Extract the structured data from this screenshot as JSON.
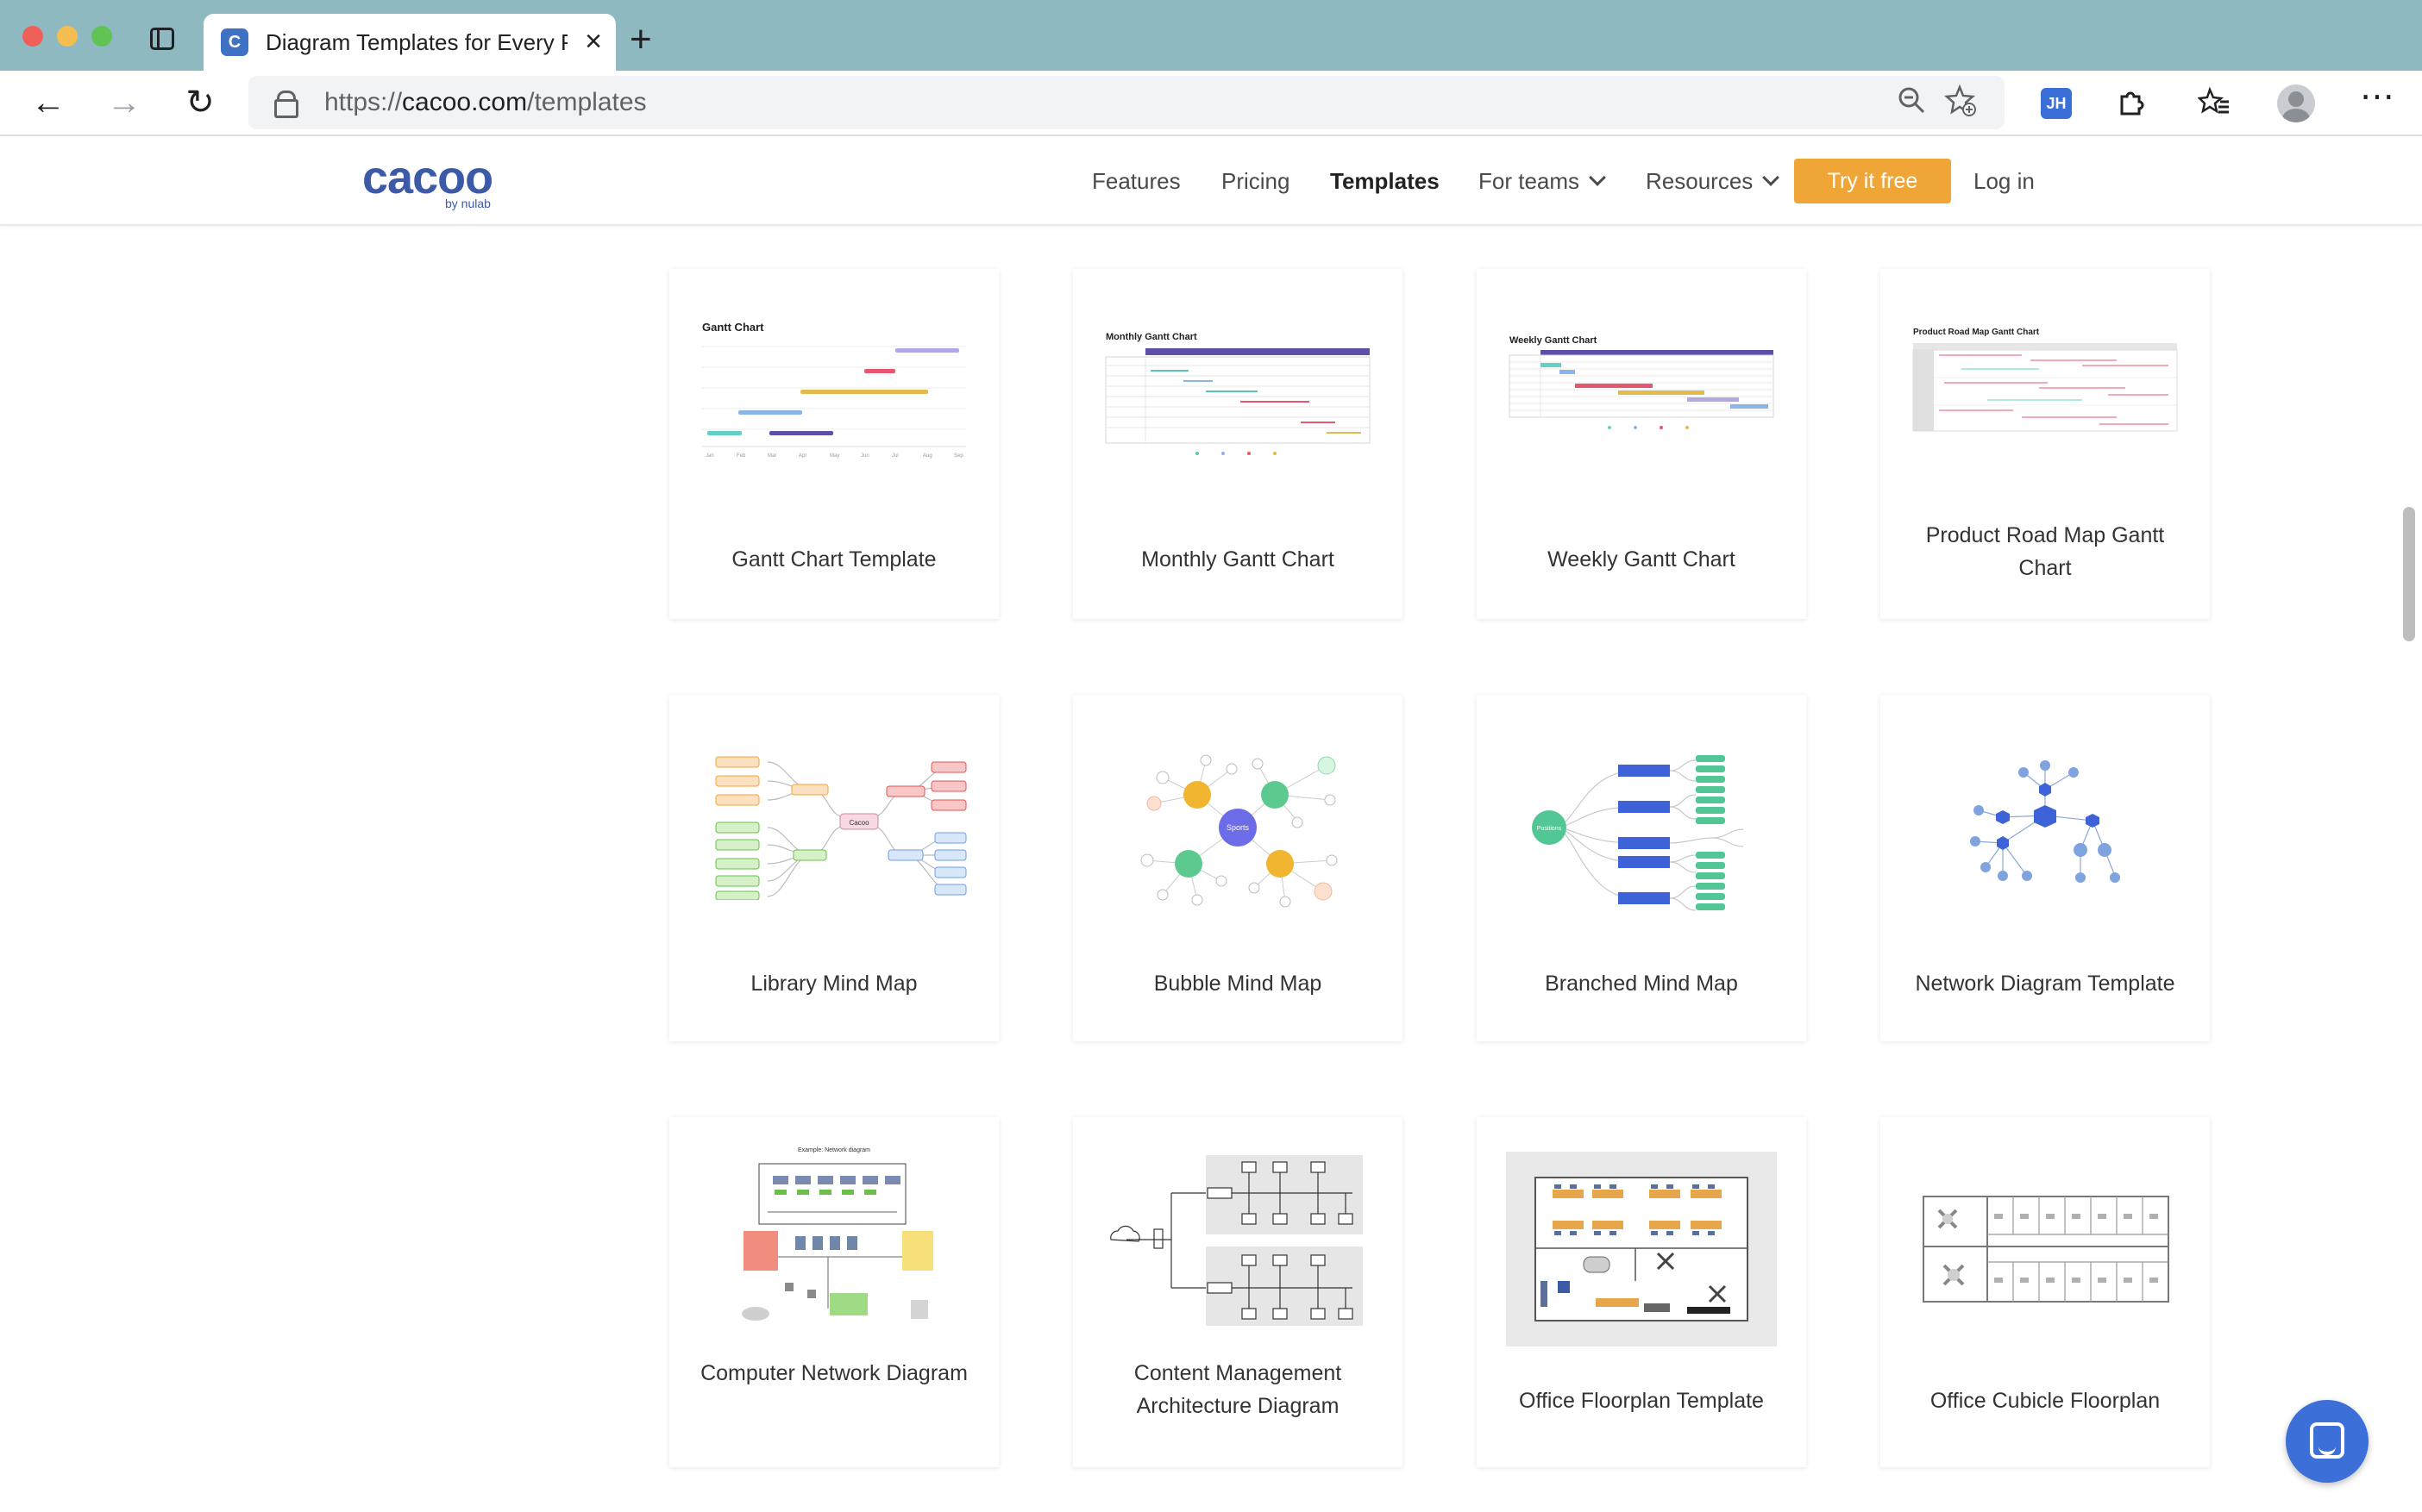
{
  "browser": {
    "tab_title": "Diagram Templates for Every P",
    "tab_favicon": "C",
    "url_scheme": "https://",
    "url_host": "cacoo.com",
    "url_path": "/templates",
    "extension_badge": "JH"
  },
  "header": {
    "logo": "cacoo",
    "logo_sub": "by nulab",
    "nav": {
      "features": "Features",
      "pricing": "Pricing",
      "templates": "Templates",
      "for_teams": "For teams",
      "resources": "Resources",
      "try_free": "Try it free",
      "login": "Log in"
    }
  },
  "cards": [
    {
      "label": "Gantt Chart Template",
      "thumb_title": "Gantt Chart"
    },
    {
      "label": "Monthly Gantt Chart",
      "thumb_title": "Monthly Gantt Chart"
    },
    {
      "label": "Weekly Gantt Chart",
      "thumb_title": "Weekly Gantt Chart"
    },
    {
      "label": "Product Road Map Gantt Chart",
      "thumb_title": "Product Road Map Gantt Chart"
    },
    {
      "label": "Library Mind Map",
      "thumb_title": "Cacoo"
    },
    {
      "label": "Bubble Mind Map",
      "thumb_title": "Sports"
    },
    {
      "label": "Branched Mind Map",
      "thumb_title": "Positions"
    },
    {
      "label": "Network Diagram Template"
    },
    {
      "label": "Computer Network Diagram",
      "thumb_title": "Example: Network diagram"
    },
    {
      "label": "Content Management Architecture Diagram"
    },
    {
      "label": "Office Floorplan Template"
    },
    {
      "label": "Office Cubicle Floorplan"
    }
  ],
  "colors": {
    "brand": "#3d5aa8",
    "cta": "#f0a637",
    "chrome_tabbar": "#8fb9c0",
    "chat": "#3d6fd9"
  }
}
